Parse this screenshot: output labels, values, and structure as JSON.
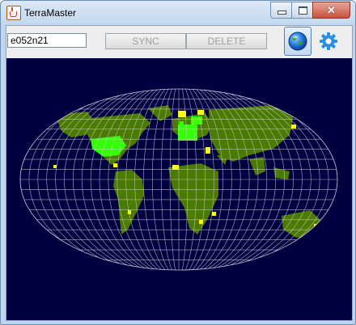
{
  "window": {
    "title": "TerraMaster",
    "minimize_label": "",
    "maximize_label": "",
    "close_label": "✕"
  },
  "toolbar": {
    "tile_input_value": "e052n21",
    "sync_label": "SYNC",
    "delete_label": "DELETE",
    "globe_icon": "globe-icon",
    "gear_icon": "gear-icon"
  },
  "map": {
    "background_color": "#000040",
    "land_color": "#4b7a00",
    "synced_color": "#33ff00",
    "partial_color": "#ffff00",
    "graticule_color": "#c8c8d8"
  }
}
